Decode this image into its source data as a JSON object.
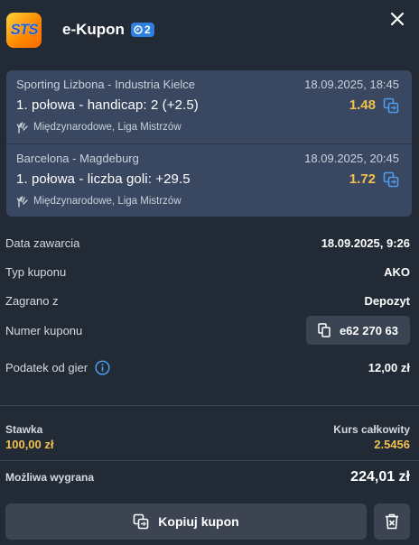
{
  "header": {
    "logo_text": "STS",
    "title": "e-Kupon",
    "badge_count": "2"
  },
  "bets": [
    {
      "teams": "Sporting Lizbona - Industria Kielce",
      "date": "18.09.2025, 18:45",
      "market": "1. połowa - handicap: 2 (+2.5)",
      "odds": "1.48",
      "league": "Międzynarodowe, Liga Mistrzów"
    },
    {
      "teams": "Barcelona - Magdeburg",
      "date": "18.09.2025, 20:45",
      "market": "1. połowa - liczba goli: +29.5",
      "odds": "1.72",
      "league": "Międzynarodowe, Liga Mistrzów"
    }
  ],
  "details": {
    "date_label": "Data zawarcia",
    "date_value": "18.09.2025, 9:26",
    "type_label": "Typ kuponu",
    "type_value": "AKO",
    "source_label": "Zagrano z",
    "source_value": "Depozyt",
    "number_label": "Numer kuponu",
    "number_value": "e62 270 63",
    "tax_label": "Podatek od gier",
    "tax_value": "12,00 zł"
  },
  "summary": {
    "stake_label": "Stawka",
    "stake_value": "100,00 zł",
    "total_odds_label": "Kurs całkowity",
    "total_odds_value": "2.5456",
    "win_label": "Możliwa wygrana",
    "win_value": "224,01 zł"
  },
  "actions": {
    "copy_label": "Kopiuj kupon"
  },
  "colors": {
    "background": "#222a36",
    "bet_card": "#3a4760",
    "accent_yellow": "#f2c14e",
    "accent_blue": "#2f7fe0",
    "button": "#3c4452"
  }
}
